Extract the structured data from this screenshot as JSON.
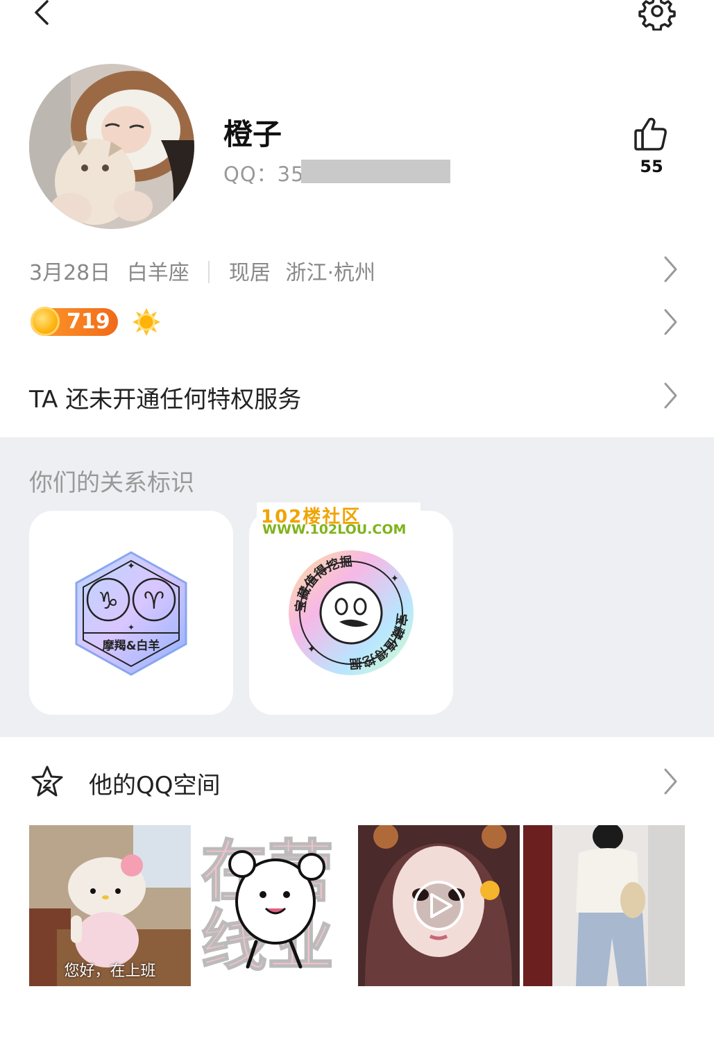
{
  "profile": {
    "nickname": "橙子",
    "qq_label": "QQ：35",
    "likes": "55",
    "birthday": "3月28日",
    "zodiac": "白羊座",
    "location_label": "现居",
    "location": "浙江·杭州",
    "level": "719"
  },
  "privilege_text": "TA 还未开通任何特权服务",
  "relationship": {
    "title": "你们的关系标识",
    "badges": [
      {
        "label": "摩羯&白羊",
        "icon": "zodiac-badge-icon"
      },
      {
        "label": "宝藏值得挖掘",
        "icon": "treasure-badge-icon"
      }
    ]
  },
  "watermark": {
    "cn": "102楼社区",
    "en": "WWW.102LOU.COM"
  },
  "qzone": {
    "title": "他的QQ空间",
    "photos": [
      {
        "caption": "您好，在上班"
      },
      {
        "caption": ""
      },
      {
        "caption": ""
      },
      {
        "caption": ""
      }
    ],
    "sticker_text": "在线营业"
  },
  "colors": {
    "accent_orange": "#f47a1f",
    "background_gray": "#eeeff3"
  }
}
